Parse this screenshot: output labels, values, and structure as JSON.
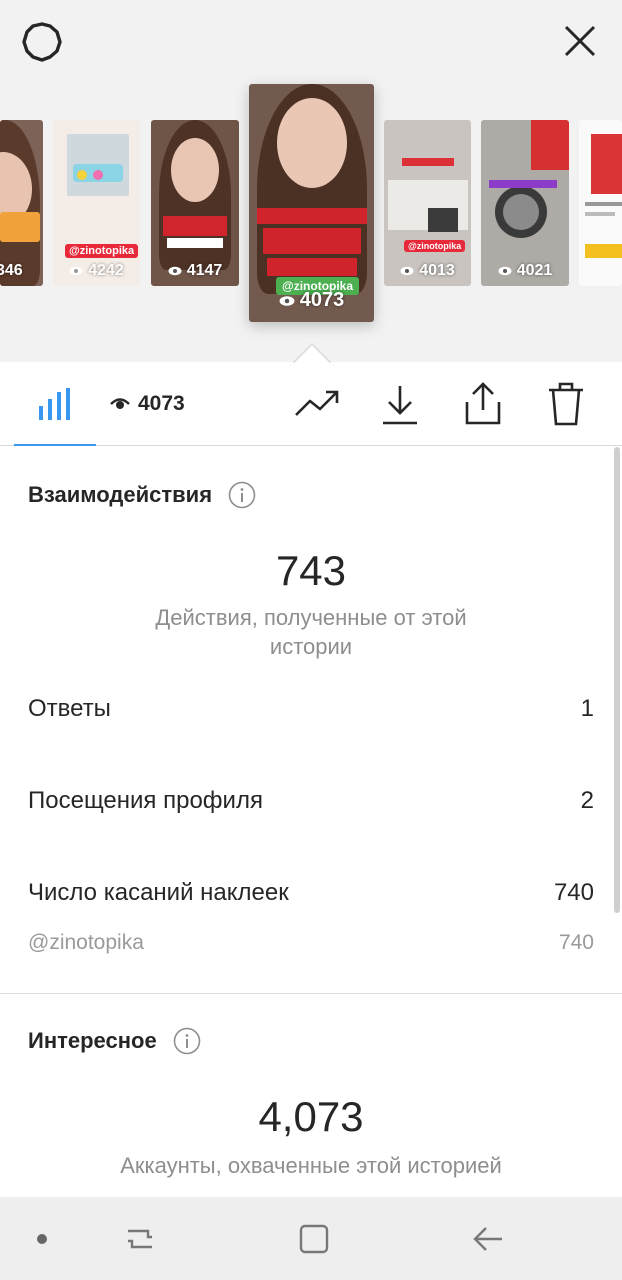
{
  "stories": {
    "thumbs": [
      {
        "count": "346"
      },
      {
        "count": "4242",
        "tag": "@zinotopika"
      },
      {
        "count": "4147"
      },
      {
        "count": "4073",
        "tag": "@zinotopika",
        "selected": true
      },
      {
        "count": "4013",
        "tag": "@zinotopika"
      },
      {
        "count": "4021"
      },
      {
        "count": ""
      }
    ]
  },
  "toolbar": {
    "views": "4073"
  },
  "interactions": {
    "title": "Взаимодействия",
    "total": "743",
    "subtitle": "Действия, полученные от этой истории",
    "rows": [
      {
        "label": "Ответы",
        "value": "1"
      },
      {
        "label": "Посещения профиля",
        "value": "2"
      },
      {
        "label": "Число касаний наклеек",
        "value": "740"
      }
    ],
    "sub_rows": [
      {
        "label": "@zinotopika",
        "value": "740"
      }
    ]
  },
  "discovery": {
    "title": "Интересное",
    "total": "4,073",
    "subtitle": "Аккаунты, охваченные этой историей"
  },
  "colors": {
    "accent": "#3897f0",
    "sticker_red": "#e8293a"
  }
}
